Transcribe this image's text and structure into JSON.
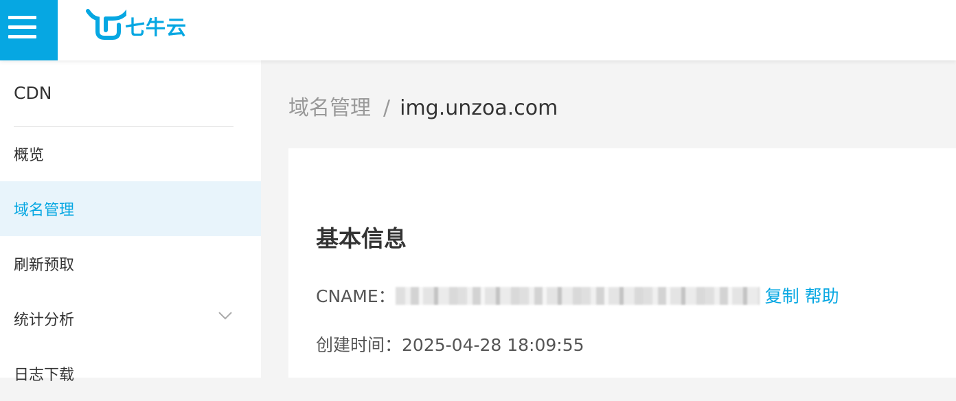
{
  "brand": {
    "name": "七牛云",
    "color": "#06a7e2"
  },
  "sidebar": {
    "title": "CDN",
    "items": [
      {
        "label": "概览"
      },
      {
        "label": "域名管理",
        "active": true
      },
      {
        "label": "刷新预取"
      },
      {
        "label": "统计分析",
        "icon": "chevron-down-icon"
      },
      {
        "label": "日志下载"
      }
    ]
  },
  "breadcrumb": {
    "parent": "域名管理",
    "separator": "/",
    "current": "img.unzoa.com"
  },
  "basic_info": {
    "title": "基本信息",
    "cname_label": "CNAME：",
    "copy_label": "复制",
    "help_label": "帮助",
    "created_label": "创建时间：",
    "created_value": "2025-04-28 18:09:55"
  }
}
